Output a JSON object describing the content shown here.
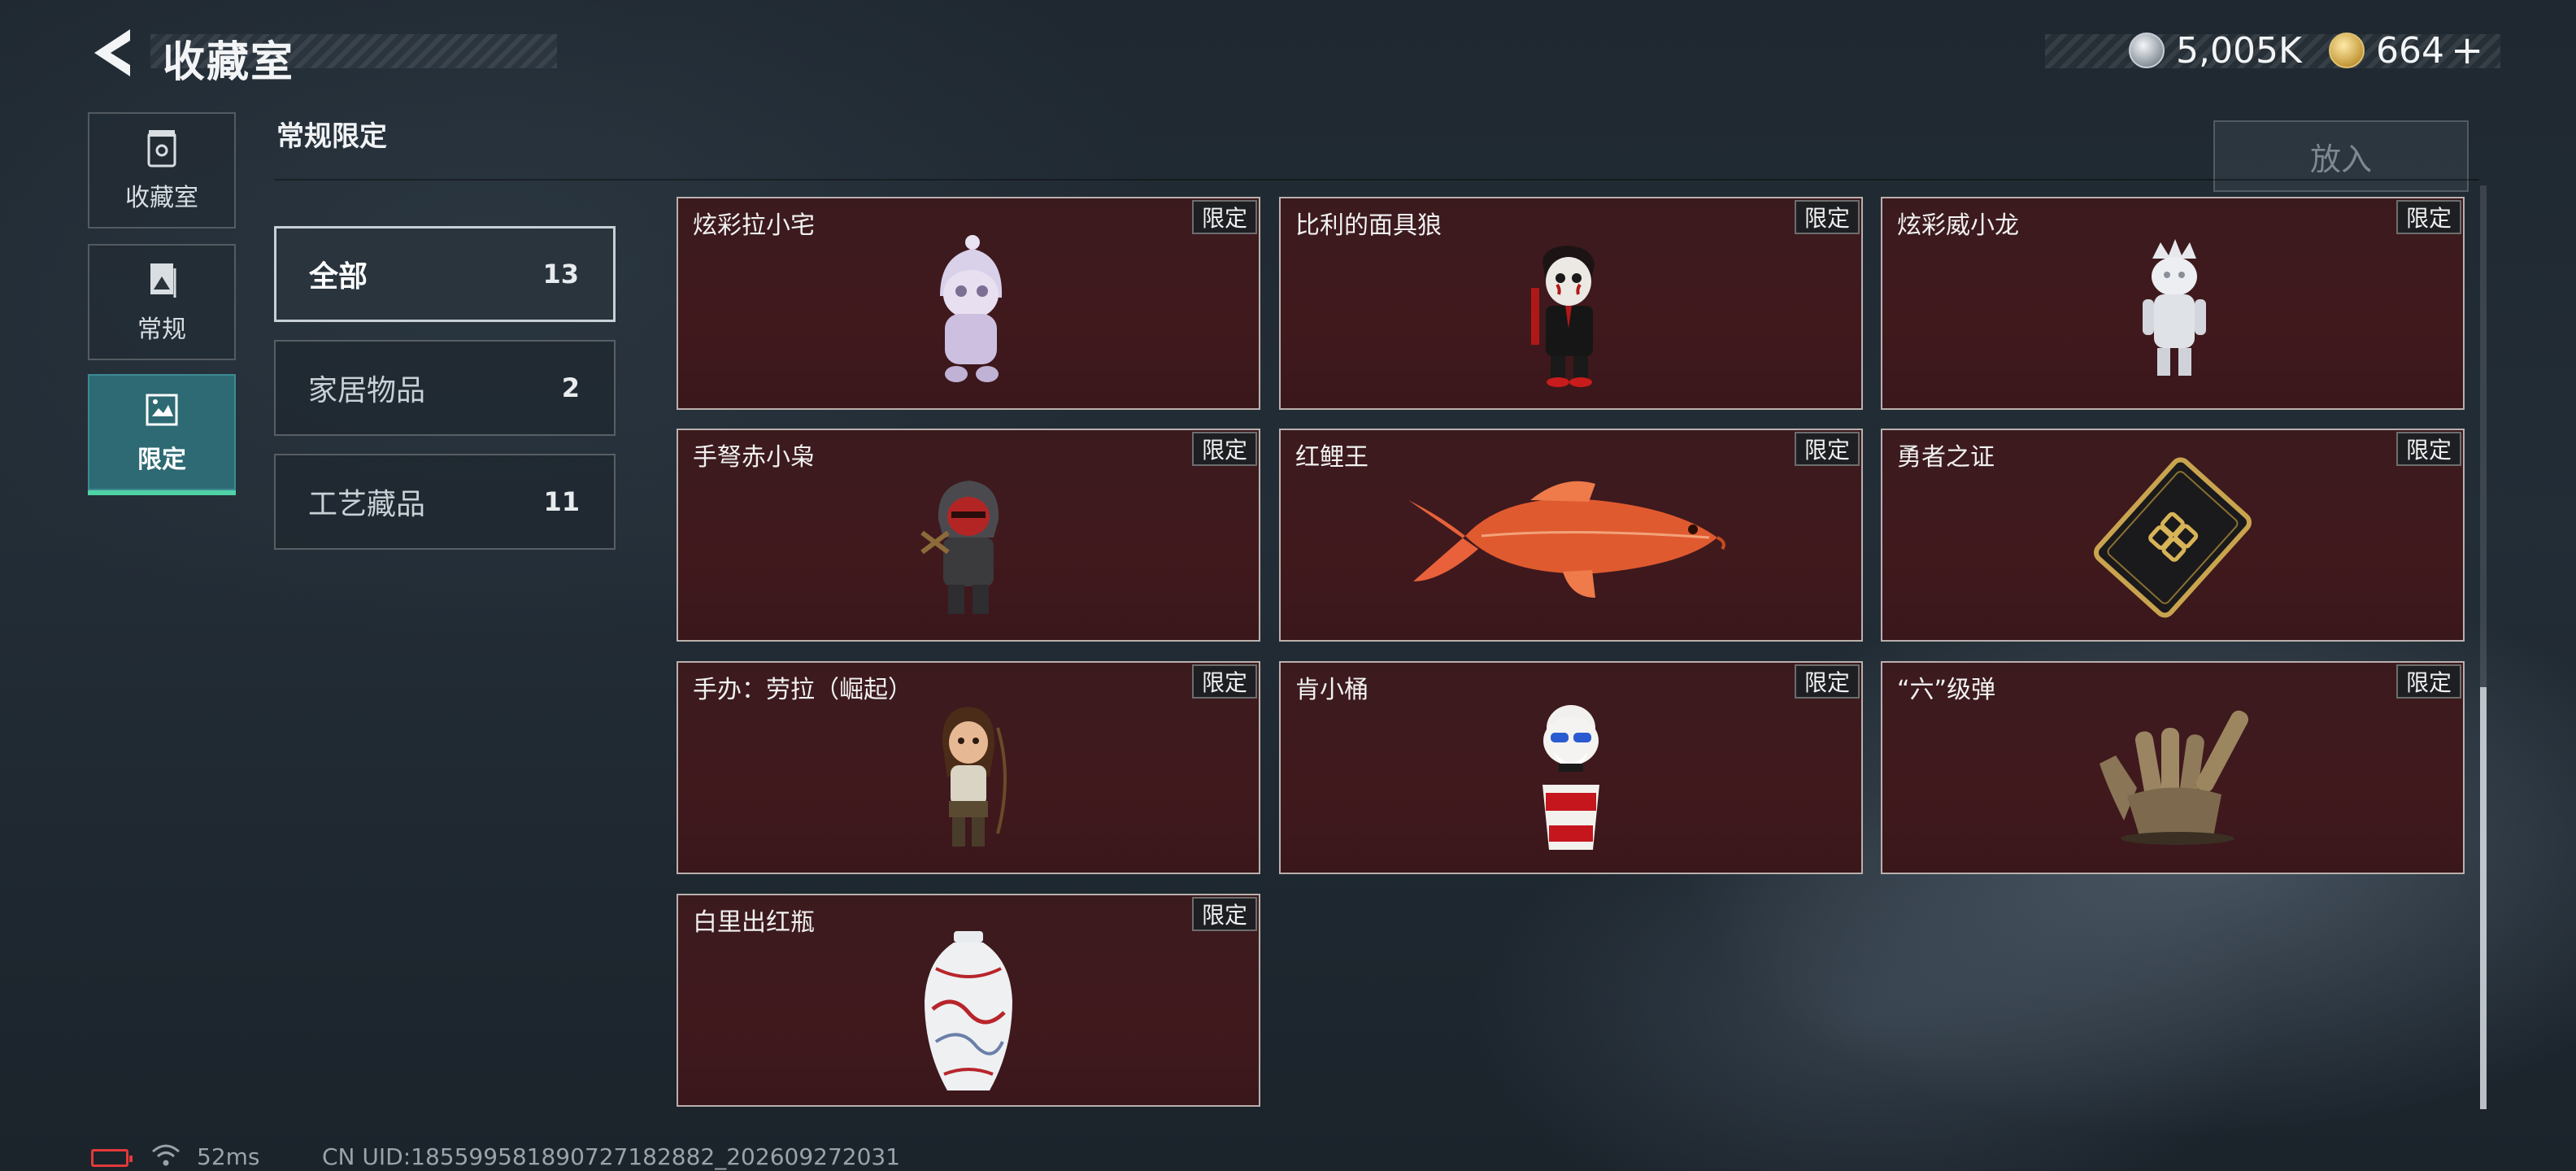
{
  "header": {
    "title": "收藏室",
    "back_icon": "back-arrow-icon",
    "currencies": [
      {
        "icon": "silver-coin-icon",
        "amount": "5,005K",
        "color": "#b8c0c8"
      },
      {
        "icon": "gold-coin-icon",
        "amount": "664",
        "color": "#d6b25a",
        "add_label": "+"
      }
    ]
  },
  "nav": {
    "tabs": [
      {
        "label": "收藏室",
        "icon": "collection-room-icon"
      },
      {
        "label": "常规",
        "icon": "regular-icon"
      },
      {
        "label": "限定",
        "icon": "limited-icon",
        "active": true
      }
    ],
    "active_color": "#2d6a73",
    "indicator_color": "#4fd2a5"
  },
  "section": {
    "title": "常规限定"
  },
  "categories": [
    {
      "name": "全部",
      "count": "13",
      "active": true
    },
    {
      "name": "家居物品",
      "count": "2"
    },
    {
      "name": "工艺藏品",
      "count": "11"
    }
  ],
  "actions": {
    "put_in_label": "放入"
  },
  "items": [
    {
      "name": "炫彩拉小宅",
      "tag": "限定",
      "icon": "hooded-figure-icon"
    },
    {
      "name": "比利的面具狼",
      "tag": "限定",
      "icon": "puppet-figure-icon"
    },
    {
      "name": "炫彩威小龙",
      "tag": "限定",
      "icon": "crown-figure-icon"
    },
    {
      "name": "手弩赤小枭",
      "tag": "限定",
      "icon": "archer-figure-icon"
    },
    {
      "name": "红鲤王",
      "tag": "限定",
      "icon": "koi-fish-icon"
    },
    {
      "name": "勇者之证",
      "tag": "限定",
      "icon": "badge-card-icon"
    },
    {
      "name": "手办：劳拉（崛起）",
      "tag": "限定",
      "icon": "adventurer-figure-icon"
    },
    {
      "name": "肯小桶",
      "tag": "限定",
      "icon": "bucket-figure-icon"
    },
    {
      "name": "“六”级弹",
      "tag": "限定",
      "icon": "bullet-hand-icon"
    },
    {
      "name": "白里出红瓶",
      "tag": "限定",
      "icon": "porcelain-vase-icon"
    }
  ],
  "item_style": {
    "background": "#3d181c",
    "tag_background": "#1d1f22"
  },
  "status": {
    "ping": "52ms",
    "uid": "CN UID:185599581890727182882_202609272031",
    "battery_color": "#e23a3a"
  }
}
